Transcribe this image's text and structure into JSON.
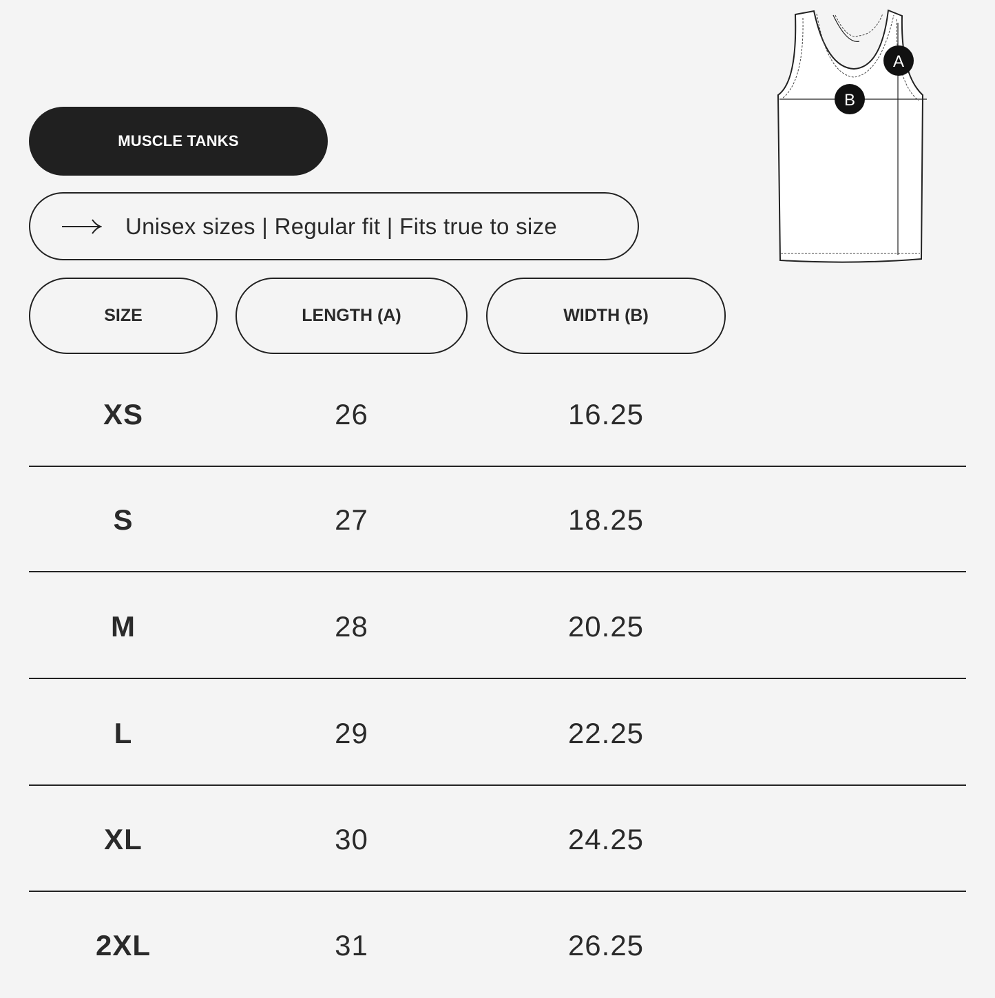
{
  "title": "MUSCLE TANKS",
  "info": {
    "icon": "arrow-right-icon",
    "text": "Unisex sizes | Regular fit | Fits true to size"
  },
  "table": {
    "headers": [
      "SIZE",
      "LENGTH (A)",
      "WIDTH (B)"
    ],
    "rows": [
      {
        "size": "XS",
        "length": "26",
        "width": "16.25"
      },
      {
        "size": "S",
        "length": "27",
        "width": "18.25"
      },
      {
        "size": "M",
        "length": "28",
        "width": "20.25"
      },
      {
        "size": "L",
        "length": "29",
        "width": "22.25"
      },
      {
        "size": "XL",
        "length": "30",
        "width": "24.25"
      },
      {
        "size": "2XL",
        "length": "31",
        "width": "26.25"
      }
    ]
  },
  "diagram": {
    "icon": "tank-top-diagram-icon",
    "label_a": "A",
    "label_b": "B"
  },
  "colors": {
    "background": "#f4f4f4",
    "dark": "#202020",
    "text": "#2a2a2a"
  }
}
